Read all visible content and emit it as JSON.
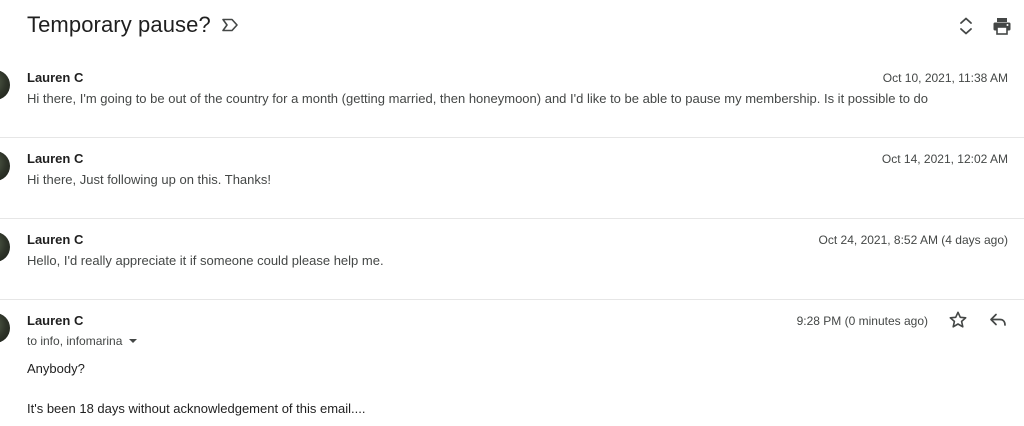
{
  "thread": {
    "subject": "Temporary pause?"
  },
  "messages": [
    {
      "sender": "Lauren C",
      "date": "Oct 10, 2021, 11:38 AM",
      "snippet": "Hi there, I'm going to be out of the country for a month (getting married, then honeymoon) and I'd like to be able to pause my membership. Is it possible to do"
    },
    {
      "sender": "Lauren C",
      "date": "Oct 14, 2021, 12:02 AM",
      "snippet": "Hi there, Just following up on this. Thanks!"
    },
    {
      "sender": "Lauren C",
      "date": "Oct 24, 2021, 8:52 AM (4 days ago)",
      "snippet": "Hello, I'd really appreciate it if someone could please help me."
    }
  ],
  "open_message": {
    "sender": "Lauren C",
    "date": "9:28 PM (0 minutes ago)",
    "recipients": "to info, infomarina",
    "body": [
      "Anybody?",
      "It's been 18 days without acknowledgement of this email...."
    ]
  },
  "icons": {
    "label": "label-icon",
    "expand": "unfold-more-icon",
    "print": "print-icon",
    "star": "star-icon",
    "reply": "reply-icon"
  }
}
